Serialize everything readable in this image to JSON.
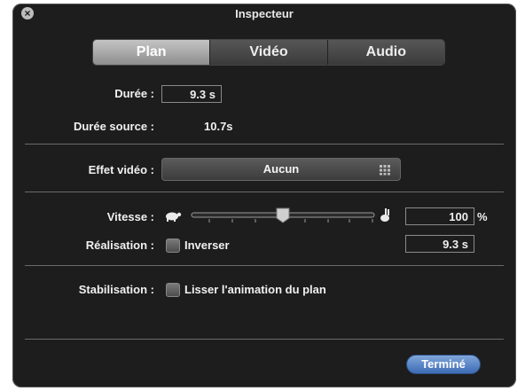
{
  "window": {
    "title": "Inspecteur"
  },
  "tabs": [
    {
      "label": "Plan",
      "active": true
    },
    {
      "label": "Vidéo",
      "active": false
    },
    {
      "label": "Audio",
      "active": false
    }
  ],
  "duree": {
    "label": "Durée :",
    "value": "9.3 s"
  },
  "duree_source": {
    "label": "Durée source :",
    "value": "10.7s"
  },
  "effet_video": {
    "label": "Effet vidéo :",
    "value": "Aucun"
  },
  "vitesse": {
    "label": "Vitesse :",
    "value": "100",
    "unit": "%",
    "slider_level_percent": 50
  },
  "realisation": {
    "label": "Réalisation :",
    "checkbox_label": "Inverser",
    "checked": false,
    "value": "9.3 s"
  },
  "stabilisation": {
    "label": "Stabilisation :",
    "checkbox_label": "Lisser l'animation du plan",
    "checked": false
  },
  "done_button": {
    "label": "Terminé"
  },
  "colors": {
    "window_bg": "#0c0c0c",
    "accent_button": "#4f7ec6",
    "text": "#f0f0f0"
  },
  "icons": {
    "close": "close-icon",
    "slow": "turtle-icon",
    "fast": "rabbit-icon",
    "grid": "grid-icon"
  }
}
